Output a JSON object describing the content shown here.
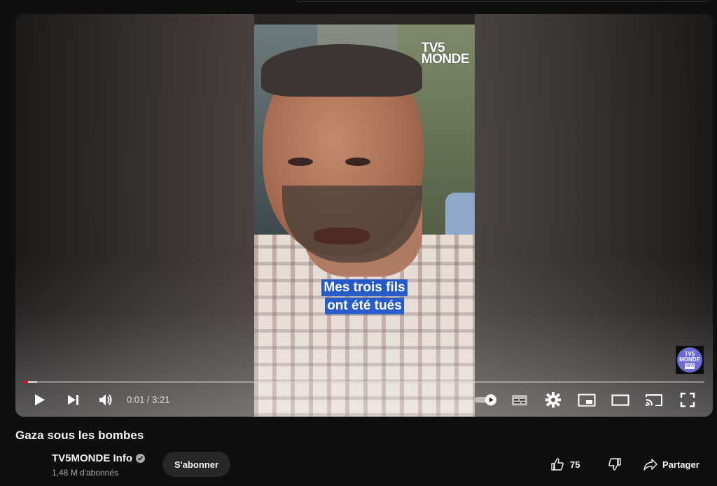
{
  "video": {
    "watermark_line1": "TV5",
    "watermark_line2": "MONDE",
    "subtitle_line1": "Mes trois fils",
    "subtitle_line2": "ont été tués",
    "badge_line1": "TV5",
    "badge_line2": "MONDE",
    "badge_tiny": "INFO",
    "progress_played_fraction": 0.005,
    "progress_loaded_fraction": 0.02
  },
  "controls": {
    "current_time": "0:01",
    "duration": "3:21",
    "time_separator": " / ",
    "icons": [
      "play-icon",
      "next-icon",
      "volume-icon",
      "autoplay-toggle-icon",
      "subtitles-icon",
      "settings-icon",
      "miniplayer-icon",
      "theater-mode-icon",
      "cast-icon",
      "fullscreen-icon"
    ]
  },
  "meta": {
    "title": "Gaza sous les bombes",
    "channel_name": "TV5MONDE Info",
    "subscribers": "1,48 M d'abonnés",
    "subscribe_label": "S'abonner",
    "like_count": "75",
    "share_label": "Partager"
  },
  "colors": {
    "progress": "#ff0000",
    "subtitle_bg": "#1f54c8",
    "background": "#0f0f0f"
  }
}
